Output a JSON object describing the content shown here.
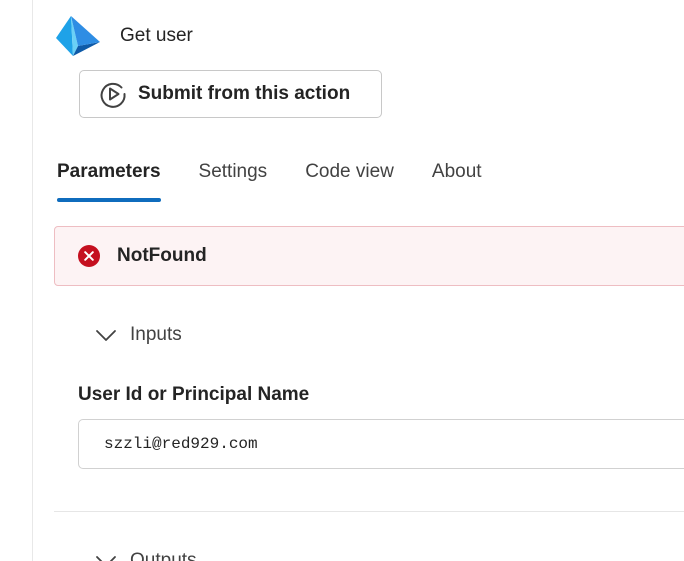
{
  "action": {
    "title": "Get user",
    "icon": "azure-ad-logo-icon"
  },
  "submit_button": {
    "label": "Submit from this action",
    "icon": "play-circle-icon"
  },
  "tabs": [
    {
      "label": "Parameters",
      "active": true
    },
    {
      "label": "Settings",
      "active": false
    },
    {
      "label": "Code view",
      "active": false
    },
    {
      "label": "About",
      "active": false
    }
  ],
  "error": {
    "message": "NotFound",
    "icon": "error-circle-icon",
    "color": "#c50f1f"
  },
  "inputs": {
    "section_label": "Inputs",
    "field_label": "User Id or Principal Name",
    "field_value": "szzli@red929.com"
  },
  "outputs": {
    "section_label": "Outputs"
  },
  "colors": {
    "accent": "#0f6cbd",
    "error": "#c50f1f",
    "error_bg": "#fdf3f4"
  }
}
